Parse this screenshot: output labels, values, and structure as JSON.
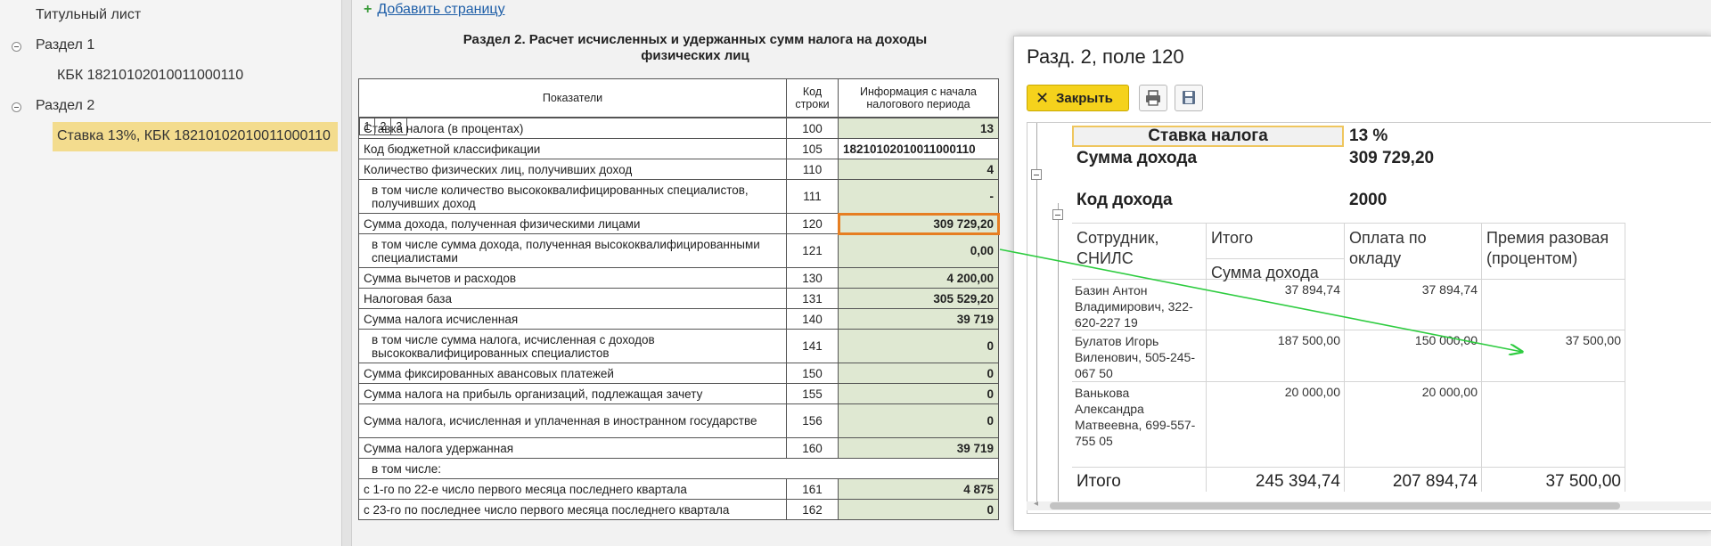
{
  "tree": {
    "items": [
      {
        "label": "Титульный лист"
      },
      {
        "label": "Раздел 1"
      },
      {
        "label": "КБК 18210102010011000110"
      },
      {
        "label": "Раздел 2"
      },
      {
        "label": "Ставка 13%, КБК 18210102010011000110"
      }
    ]
  },
  "doc": {
    "add_page": "Добавить страницу",
    "add_plus": "+",
    "section_title": "Раздел 2. Расчет исчисленных и удержанных сумм налога на доходы физических лиц",
    "headers": {
      "col1": "Показатели",
      "col2": "Код строки",
      "col3": "Информация с начала налогового периода",
      "n1": "1",
      "n2": "2",
      "n3": "3"
    },
    "rows": [
      {
        "label": "Ставка налога (в процентах)",
        "code": "100",
        "value": "13"
      },
      {
        "label": "Код бюджетной классификации",
        "code": "105",
        "value": "18210102010011000110"
      },
      {
        "label": "Количество физических лиц, получивших доход",
        "code": "110",
        "value": "4"
      },
      {
        "label": "в том числе количество высококвалифицированных специалистов, получивших доход",
        "code": "111",
        "value": "-"
      },
      {
        "label": "Сумма дохода, полученная физическими лицами",
        "code": "120",
        "value": "309 729,20"
      },
      {
        "label": "в том числе сумма дохода, полученная высококвалифицированными специалистами",
        "code": "121",
        "value": "0,00"
      },
      {
        "label": "Сумма вычетов и расходов",
        "code": "130",
        "value": "4 200,00"
      },
      {
        "label": "Налоговая база",
        "code": "131",
        "value": "305 529,20"
      },
      {
        "label": "Сумма налога исчисленная",
        "code": "140",
        "value": "39 719"
      },
      {
        "label": "в том числе сумма налога, исчисленная с доходов высококвалифицированных специалистов",
        "code": "141",
        "value": "0"
      },
      {
        "label": "Сумма фиксированных авансовых платежей",
        "code": "150",
        "value": "0"
      },
      {
        "label": "Сумма налога на прибыль организаций, подлежащая зачету",
        "code": "155",
        "value": "0"
      },
      {
        "label": "Сумма налога, исчисленная и уплаченная в иностранном государстве",
        "code": "156",
        "value": "0"
      },
      {
        "label": "Сумма налога удержанная",
        "code": "160",
        "value": "39 719"
      },
      {
        "label": "в том числе:",
        "code": "",
        "value": ""
      },
      {
        "label": "с 1-го по 22-е число первого месяца последнего квартала",
        "code": "161",
        "value": "4 875"
      },
      {
        "label": "с 23-го по последнее число первого месяца последнего квартала",
        "code": "162",
        "value": "0"
      }
    ]
  },
  "popup": {
    "title": "Разд. 2, поле 120",
    "close_label": "Закрыть",
    "rate_label": "Ставка налога",
    "rate_value": "13 %",
    "income_label": "Сумма дохода",
    "income_value": "309 729,20",
    "code_label": "Код дохода",
    "code_value": "2000",
    "col_employee": "Сотрудник, СНИЛС",
    "col_total": "Итого",
    "col_total_sub": "Сумма дохода",
    "col_salary": "Оплата по окладу",
    "col_bonus": "Премия разовая (процентом)",
    "employees": [
      {
        "name": "Базин Антон Владимирович, 322-620-227 19",
        "total": "37 894,74",
        "salary": "37 894,74",
        "bonus": ""
      },
      {
        "name": "Булатов Игорь Виленович, 505-245-067 50",
        "total": "187 500,00",
        "salary": "150 000,00",
        "bonus": "37 500,00"
      },
      {
        "name": "Ванькова Александра Матвеевна, 699-557-755 05",
        "total": "20 000,00",
        "salary": "20 000,00",
        "bonus": ""
      }
    ],
    "totals": {
      "label": "Итого",
      "total": "245 394,74",
      "salary": "207 894,74",
      "bonus": "37 500,00"
    }
  },
  "colors": {
    "highlight": "#e67e22",
    "arrow": "#2ecc40",
    "selected": "#f3dc8e",
    "cell_green": "#dfe8d2",
    "button_yellow": "#f5d21c"
  }
}
